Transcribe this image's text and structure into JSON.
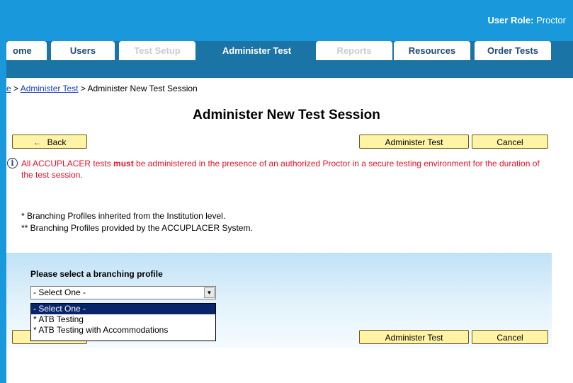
{
  "header": {
    "user_role_label": "User Role:",
    "user_role_value": "Proctor"
  },
  "tabs": [
    {
      "label": "ome",
      "state": "normal"
    },
    {
      "label": "Users",
      "state": "normal"
    },
    {
      "label": "Test Setup",
      "state": "disabled"
    },
    {
      "label": "Administer Test",
      "state": "active"
    },
    {
      "label": "Reports",
      "state": "disabled"
    },
    {
      "label": "Resources",
      "state": "normal"
    },
    {
      "label": "Order Tests",
      "state": "normal"
    }
  ],
  "breadcrumb": {
    "home_fragment": "e",
    "sep1": " > ",
    "link": "Administer Test",
    "sep2": " > ",
    "current": "Administer New Test Session"
  },
  "page": {
    "title": "Administer New Test Session"
  },
  "buttons": {
    "back_icon": "←",
    "back": "Back",
    "administer": "Administer Test",
    "cancel": "Cancel"
  },
  "notice": {
    "icon": "info-icon",
    "part1": "All ACCUPLACER tests ",
    "emphasis": "must",
    "part2": " be administered in the presence of an authorized Proctor in a secure testing environment for the duration of the test session."
  },
  "footnotes": [
    "* Branching Profiles inherited from the Institution level.",
    "** Branching Profiles provided by the ACCUPLACER System."
  ],
  "branching": {
    "label": "Please select a branching profile",
    "selected": "- Select One -",
    "options": [
      "- Select One -",
      "* ATB Testing",
      "* ATB Testing with Accommodations"
    ]
  },
  "colors": {
    "header_blue": "#1a98dc",
    "tab_bar_blue": "#1b74a6",
    "button_yellow": "#fff4a6",
    "notice_red": "#e8102a"
  }
}
